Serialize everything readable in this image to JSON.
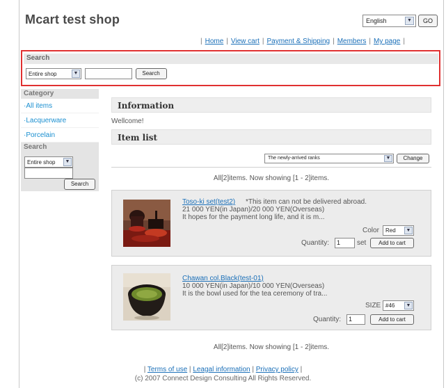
{
  "shop_title": "Mcart test shop",
  "language": {
    "selected": "English",
    "go_label": "GO"
  },
  "topnav": {
    "home": "Home",
    "view_cart": "View cart",
    "payment": "Payment & Shipping",
    "members": "Members",
    "my_page": "My page"
  },
  "search": {
    "heading": "Search",
    "scope": "Entire shop",
    "button": "Search"
  },
  "sidebar": {
    "category_heading": "Category",
    "items": [
      "·All items",
      "·Lacquerware",
      "·Porcelain"
    ],
    "search_heading": "Search",
    "search_scope": "Entire shop",
    "search_button": "Search"
  },
  "main": {
    "info_heading": "Information",
    "welcome": "Wellcome!",
    "list_heading": "Item list",
    "sort_option": "The newly-arrived ranks",
    "change_button": "Change",
    "showing": "All[2]items. Now showing [1 - 2]items."
  },
  "items": [
    {
      "title": "Toso-ki set(test2)",
      "note": " *This item can not be delivered abroad.",
      "price": "21 000 YEN(in Japan)/20 000 YEN(Overseas)",
      "desc": "It hopes for the payment long life, and it is m...",
      "option_label": "Color",
      "option_value": "Red",
      "quantity_label": "Quantity:",
      "quantity": "1",
      "unit": "set",
      "add_button": "Add to cart"
    },
    {
      "title": "Chawan col.Black(test-01)",
      "note": "",
      "price": "10 000 YEN(in Japan)/10 000 YEN(Overseas)",
      "desc": "It is the bowl used for the tea ceremony of tra...",
      "option_label": "SIZE",
      "option_value": "#46",
      "quantity_label": "Quantity:",
      "quantity": "1",
      "unit": "",
      "add_button": "Add to cart"
    }
  ],
  "footer": {
    "terms": "Terms of use",
    "legal": "Leagal information",
    "privacy": "Privacy policy",
    "copyright": "(c) 2007 Connect Design Consulting All Rights Reserved."
  }
}
